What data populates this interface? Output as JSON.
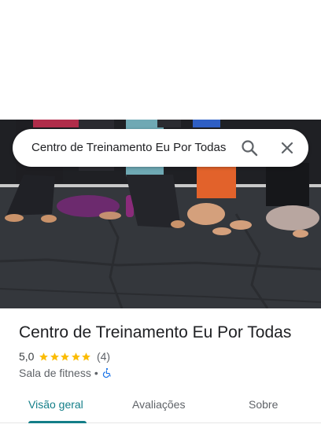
{
  "search": {
    "query": "Centro de Treinamento Eu Por Todas"
  },
  "icons": {
    "search": "search-icon",
    "close": "close-icon",
    "wheelchair": "wheelchair-accessible-icon",
    "star": "star-icon"
  },
  "place": {
    "name": "Centro de Treinamento Eu Por Todas",
    "rating": "5,0",
    "stars": 5,
    "reviews": "(4)",
    "category": "Sala de fitness",
    "separator": "•"
  },
  "tabs": [
    {
      "label": "Visão geral",
      "active": true
    },
    {
      "label": "Avaliações",
      "active": false
    },
    {
      "label": "Sobre",
      "active": false
    }
  ],
  "colors": {
    "accent": "#137e88",
    "star": "#fbbc04",
    "wheelchair": "#1a73e8"
  }
}
